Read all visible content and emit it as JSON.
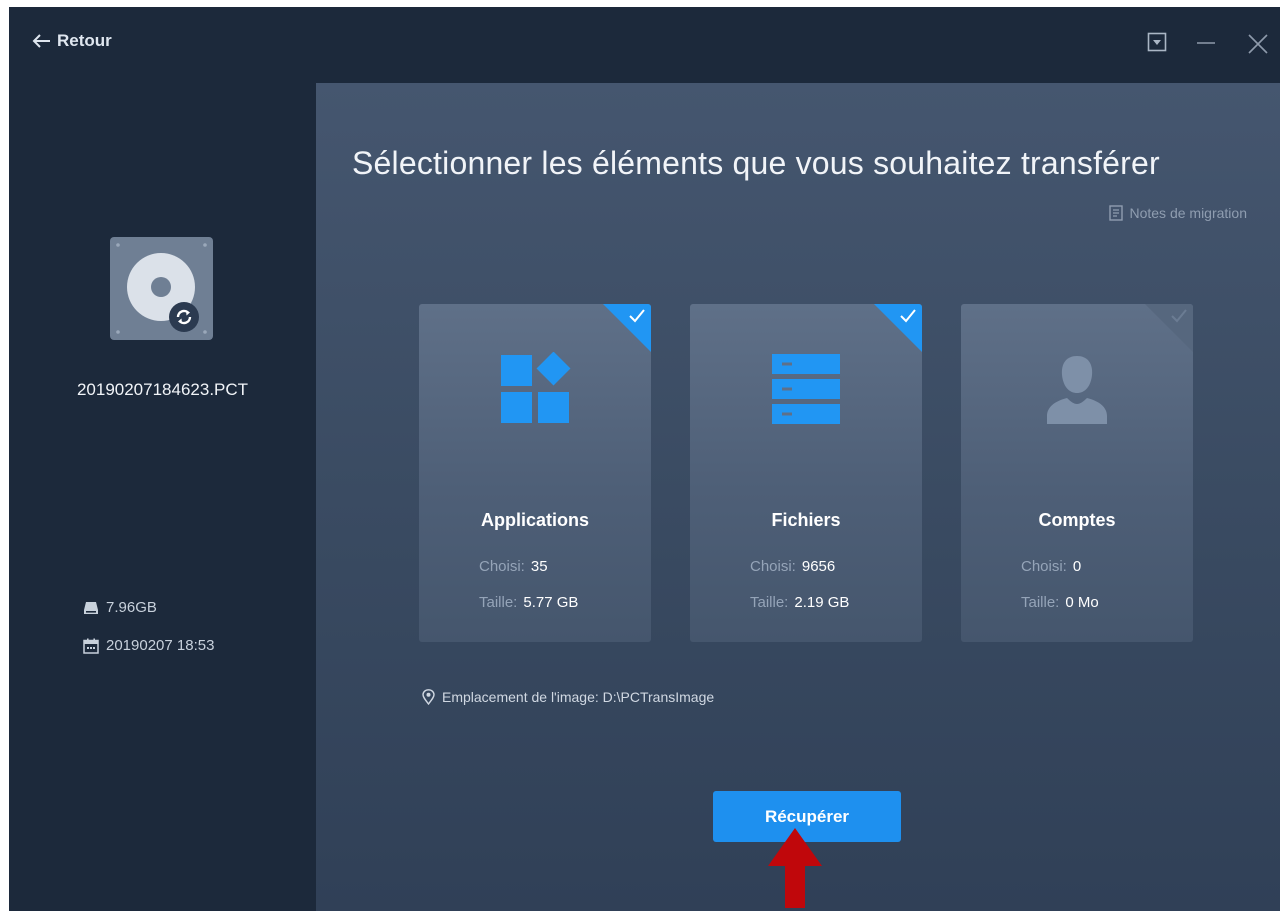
{
  "header": {
    "back_label": "Retour",
    "controls": [
      "dropdown-icon",
      "minimize-icon",
      "close-icon"
    ]
  },
  "sidebar": {
    "image_name": "20190207184623.PCT",
    "size": "7.96GB",
    "date": "20190207 18:53"
  },
  "main": {
    "title": "Sélectionner les éléments que vous souhaitez transférer",
    "notes_label": "Notes de migration",
    "cards": [
      {
        "title": "Applications",
        "chosen_label": "Choisi:",
        "chosen": "35",
        "size_label": "Taille:",
        "size": "5.77 GB",
        "checked": true,
        "icon": "apps-icon"
      },
      {
        "title": "Fichiers",
        "chosen_label": "Choisi:",
        "chosen": "9656",
        "size_label": "Taille:",
        "size": "2.19 GB",
        "checked": true,
        "icon": "files-icon"
      },
      {
        "title": "Comptes",
        "chosen_label": "Choisi:",
        "chosen": "0",
        "size_label": "Taille:",
        "size": "0 Mo",
        "checked": false,
        "icon": "user-icon"
      }
    ],
    "location_text": "Emplacement de l'image: D:\\PCTransImage",
    "recover_label": "Récupérer"
  },
  "colors": {
    "accent": "#1e90ef",
    "sidebar_bg": "#1c293b",
    "annotation_arrow": "#c0070b"
  }
}
